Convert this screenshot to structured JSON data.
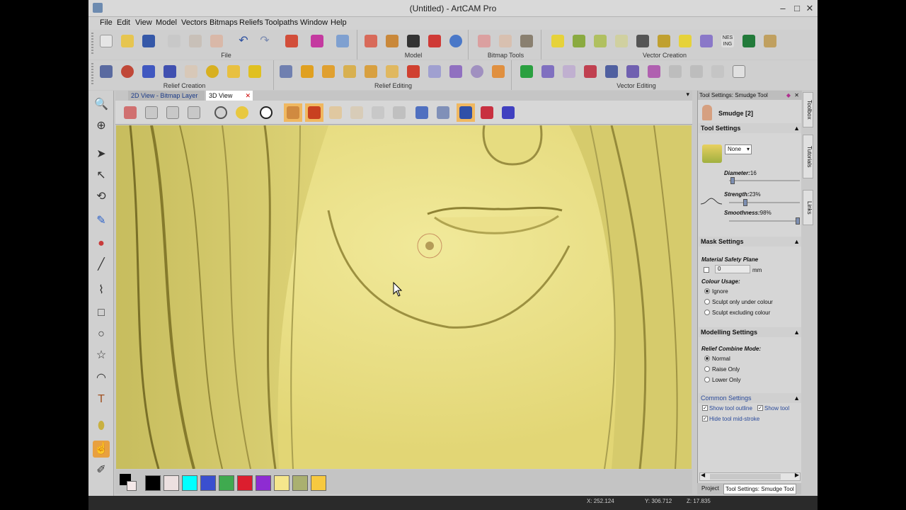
{
  "window": {
    "title": "(Untitled) - ArtCAM Pro",
    "minimize": "–",
    "maximize": "□",
    "close": "✕"
  },
  "menu": [
    "File",
    "Edit",
    "View",
    "Model",
    "Vectors",
    "Bitmaps",
    "Reliefs",
    "Toolpaths",
    "Window",
    "Help"
  ],
  "toolbar_groups_row1": [
    "File",
    "Model",
    "Bitmap Tools",
    "Vector Creation"
  ],
  "toolbar_groups_row2": [
    "Relief Creation",
    "Relief Editing",
    "Vector Editing"
  ],
  "view_tabs": [
    "2D View - Bitmap Layer",
    "3D View"
  ],
  "view_tab_close": "✕",
  "tool_panel": {
    "header": "Tool Settings: Smudge Tool",
    "tool_name": "Smudge [2]",
    "tool_settings_title": "Tool Settings",
    "layer_select": "None",
    "diameter_label": "Diameter:",
    "diameter_value": "16",
    "strength_label": "Strength:",
    "strength_value": "23%",
    "smoothness_label": "Smoothness:",
    "smoothness_value": "98%",
    "diameter_level": 0.05,
    "strength_level": 0.23,
    "smoothness_level": 0.98,
    "mask_settings_title": "Mask Settings",
    "material_safety_plane": "Material Safety Plane",
    "msp_value": "0",
    "msp_unit": "mm",
    "colour_usage": "Colour Usage:",
    "colour_options": [
      "Ignore",
      "Sculpt only under colour",
      "Sculpt excluding colour"
    ],
    "modelling_title": "Modelling Settings",
    "relief_combine_mode": "Relief Combine Mode:",
    "combine_options": [
      "Normal",
      "Raise Only",
      "Lower Only"
    ],
    "common_title": "Common Settings",
    "show_tool_outline": "Show tool outline",
    "show_tool": "Show tool",
    "hide_tool_midstroke": "Hide tool mid-stroke"
  },
  "side_tabs": [
    "Toolbox",
    "Tutorials",
    "Links"
  ],
  "bottom_tabs": [
    "Project",
    "Tool Settings: Smudge Tool"
  ],
  "status": {
    "x": "X: 252.124",
    "y": "Y: 306.712",
    "z": "Z: 17.835"
  },
  "colours": {
    "relief": "#e9e07e",
    "swatches": [
      "#000000",
      "#ece0e0",
      "#00ffff",
      "#3a4fcf",
      "#3faa4f",
      "#dc1e2e",
      "#8e2cd2",
      "#f5e68c",
      "#aab070",
      "#f7c940"
    ]
  },
  "icons": {
    "left_toolbar": [
      "zoom-icon",
      "globe-icon",
      "select-arrow-icon",
      "node-edit-icon",
      "transform-icon",
      "paintbrush-icon",
      "fill-icon",
      "line-icon",
      "polyline-icon",
      "rectangle-icon",
      "ellipse-icon",
      "star-icon",
      "arc-icon",
      "text-icon",
      "drop-icon",
      "smudge-icon",
      "sculpt-icon"
    ]
  }
}
